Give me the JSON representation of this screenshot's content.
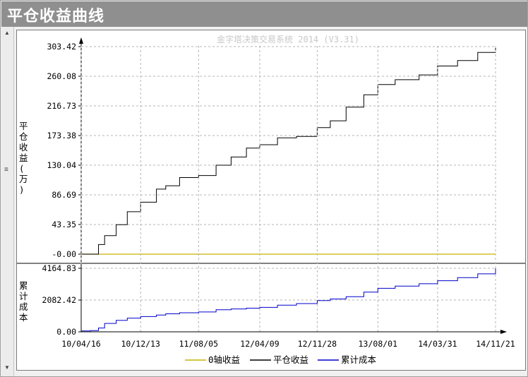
{
  "window": {
    "title": "平仓收益曲线"
  },
  "chart_panel": {
    "watermark": "金字塔决策交易系统 2014 (V3.31)"
  },
  "colors": {
    "zero_axis": "#c8b400",
    "closed_pnl": "#000000",
    "cumulative_cost": "#0000cc"
  },
  "chart_data": [
    {
      "type": "line",
      "ylabel": "平仓收益(万)",
      "yticks": [
        "303.42",
        "260.08",
        "216.73",
        "173.38",
        "130.04",
        "86.69",
        "43.35",
        "-0.00"
      ],
      "ylim": [
        -0.0,
        303.42
      ],
      "grid": true,
      "x": [
        "10/04/16",
        "10/05/25",
        "10/06/25",
        "10/07/20",
        "10/09/05",
        "10/10/20",
        "10/12/13",
        "11/02/15",
        "11/03/25",
        "11/05/20",
        "11/08/05",
        "11/10/15",
        "11/12/15",
        "12/02/15",
        "12/04/09",
        "12/06/20",
        "12/09/05",
        "12/11/28",
        "13/01/20",
        "13/03/25",
        "13/06/05",
        "13/08/01",
        "13/10/10",
        "14/01/15",
        "14/03/31",
        "14/06/20",
        "14/09/10",
        "14/11/21"
      ],
      "series": [
        {
          "name": "0轴收益",
          "values": [
            0,
            0,
            0,
            0,
            0,
            0,
            0,
            0,
            0,
            0,
            0,
            0,
            0,
            0,
            0,
            0,
            0,
            0,
            0,
            0,
            0,
            0,
            0,
            0,
            0,
            0,
            0,
            0
          ]
        },
        {
          "name": "平仓收益",
          "values": [
            0,
            0,
            14,
            27,
            43,
            62,
            76,
            95,
            100,
            112,
            115,
            130,
            142,
            155,
            160,
            170,
            172,
            185,
            195,
            215,
            233,
            248,
            255,
            262,
            275,
            283,
            295,
            303.42
          ]
        }
      ]
    },
    {
      "type": "line",
      "ylabel": "累计成本",
      "yticks": [
        "4164.83",
        "2082.42",
        "0.00"
      ],
      "ylim": [
        0.0,
        4164.83
      ],
      "grid": true,
      "x": [
        "10/04/16",
        "10/05/25",
        "10/06/25",
        "10/07/20",
        "10/09/05",
        "10/10/20",
        "10/12/13",
        "11/02/15",
        "11/03/25",
        "11/05/20",
        "11/08/05",
        "11/10/15",
        "11/12/15",
        "12/02/15",
        "12/04/09",
        "12/06/20",
        "12/09/05",
        "12/11/28",
        "13/01/20",
        "13/03/25",
        "13/06/05",
        "13/08/01",
        "13/10/10",
        "14/01/15",
        "14/03/31",
        "14/06/20",
        "14/09/10",
        "14/11/21"
      ],
      "xticks": [
        "10/04/16",
        "10/12/13",
        "11/08/05",
        "12/04/09",
        "12/11/28",
        "13/08/01",
        "14/03/31",
        "14/11/21"
      ],
      "series": [
        {
          "name": "累计成本",
          "values": [
            60,
            80,
            250,
            550,
            750,
            900,
            1000,
            1100,
            1180,
            1250,
            1300,
            1450,
            1500,
            1550,
            1600,
            1750,
            1850,
            2050,
            2150,
            2300,
            2600,
            2850,
            3000,
            3150,
            3350,
            3550,
            3800,
            4164.83
          ]
        }
      ]
    }
  ],
  "legend": [
    {
      "label": "0轴收益",
      "color": "#c8b400"
    },
    {
      "label": "平仓收益",
      "color": "#000000"
    },
    {
      "label": "累计成本",
      "color": "#0000cc"
    }
  ]
}
